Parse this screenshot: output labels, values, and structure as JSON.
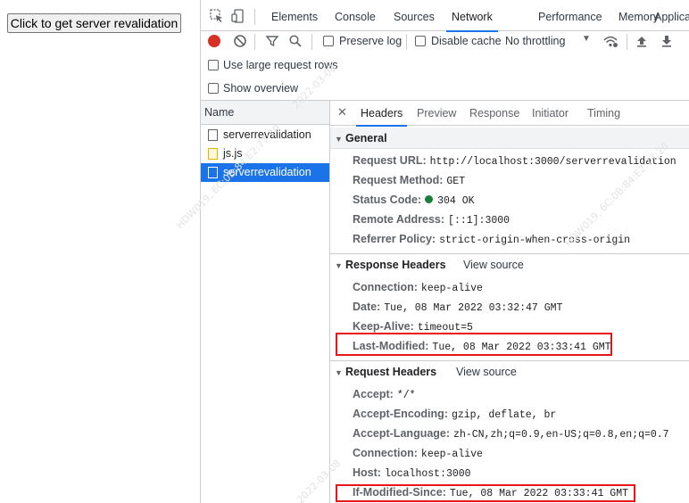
{
  "page": {
    "button_label": "Click to get server revalidation"
  },
  "devtools": {
    "tabs": [
      "Elements",
      "Console",
      "Sources",
      "Network",
      "Performance",
      "Memory",
      "Applica"
    ],
    "active_tab": "Network",
    "toolbar": {
      "preserve_log": "Preserve log",
      "disable_cache": "Disable cache",
      "throttling": "No throttling"
    },
    "options": {
      "large_rows": "Use large request rows",
      "overview": "Show overview"
    },
    "name_header": "Name",
    "requests": [
      {
        "name": "serverrevalidation",
        "type": "doc",
        "selected": false
      },
      {
        "name": "js.js",
        "type": "js",
        "selected": false
      },
      {
        "name": "serverrevalidation",
        "type": "doc",
        "selected": true
      }
    ],
    "detail_tabs": [
      "Headers",
      "Preview",
      "Response",
      "Initiator",
      "Timing"
    ],
    "active_detail_tab": "Headers",
    "general": {
      "title": "General",
      "rows": [
        {
          "key": "Request URL:",
          "value": "http://localhost:3000/serverrevalidation"
        },
        {
          "key": "Request Method:",
          "value": "GET"
        },
        {
          "key": "Status Code:",
          "value": "304 OK",
          "status_color": "#188038"
        },
        {
          "key": "Remote Address:",
          "value": "[::1]:3000"
        },
        {
          "key": "Referrer Policy:",
          "value": "strict-origin-when-cross-origin"
        }
      ]
    },
    "response_headers": {
      "title": "Response Headers",
      "view_source": "View source",
      "rows": [
        {
          "key": "Connection:",
          "value": "keep-alive"
        },
        {
          "key": "Date:",
          "value": "Tue, 08 Mar 2022 03:32:47 GMT"
        },
        {
          "key": "Keep-Alive:",
          "value": "timeout=5"
        },
        {
          "key": "Last-Modified:",
          "value": "Tue, 08 Mar 2022 03:33:41 GMT",
          "highlighted": true
        }
      ]
    },
    "request_headers": {
      "title": "Request Headers",
      "view_source": "View source",
      "rows": [
        {
          "key": "Accept:",
          "value": "*/*"
        },
        {
          "key": "Accept-Encoding:",
          "value": "gzip, deflate, br"
        },
        {
          "key": "Accept-Language:",
          "value": "zh-CN,zh;q=0.9,en-US;q=0.8,en;q=0.7"
        },
        {
          "key": "Connection:",
          "value": "keep-alive"
        },
        {
          "key": "Host:",
          "value": "localhost:3000"
        },
        {
          "key": "If-Modified-Since:",
          "value": "Tue, 08 Mar 2022 03:33:41 GMT",
          "highlighted": true
        }
      ]
    }
  },
  "watermarks": [
    "HDW019, 6C:0B:84:E2:77:20",
    "2022-03-08"
  ],
  "colors": {
    "accent": "#1a73e8",
    "record": "#d93025",
    "highlight_box": "#e8161b",
    "status_ok": "#188038"
  }
}
